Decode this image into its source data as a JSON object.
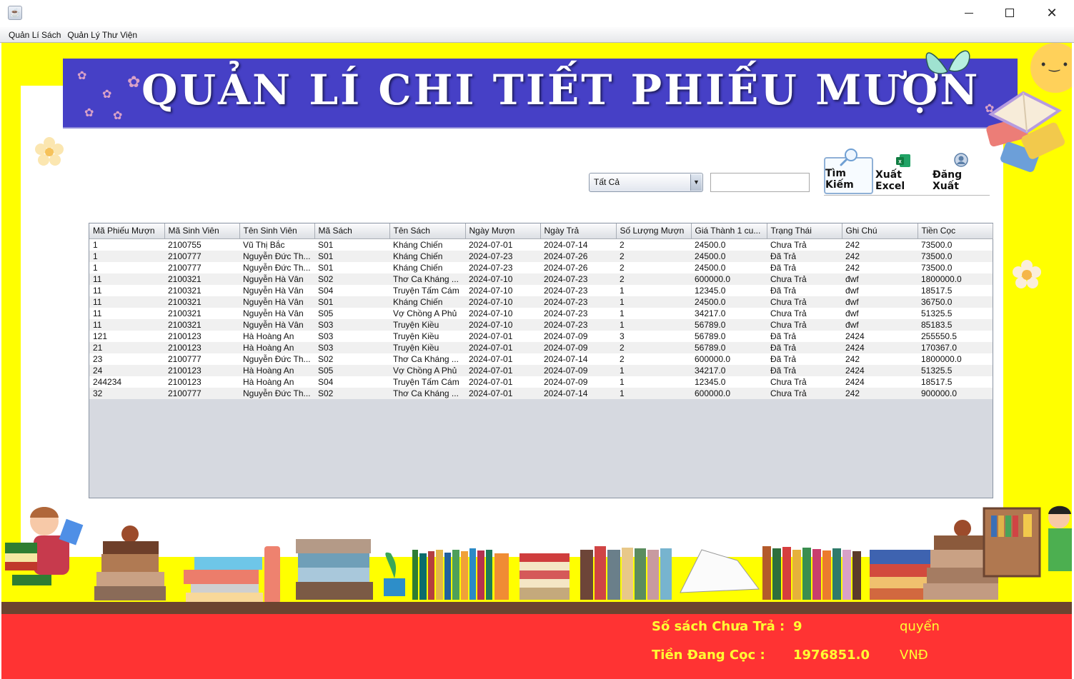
{
  "window": {
    "icon": "java-cup-icon",
    "controls": {
      "minimize": "minimize",
      "maximize": "maximize",
      "close": "close"
    }
  },
  "menu": {
    "items": [
      {
        "label": "Quản Lí Sách"
      },
      {
        "label": "Quản Lý Thư Viện"
      }
    ]
  },
  "banner": {
    "title": "QUẢN LÍ CHI TIẾT PHIẾU MƯỢN"
  },
  "search": {
    "filter_selected": "Tất Cả",
    "query_value": "",
    "search_label": "Tìm Kiếm",
    "excel_label": "Xuất Excel",
    "logout_label": "Đăng Xuất"
  },
  "table": {
    "columns": [
      "Mã Phiếu Mượn",
      "Mã Sinh Viên",
      "Tên Sinh Viên",
      "Mã Sách",
      "Tên Sách",
      "Ngày Mượn",
      "Ngày Trả",
      "Số Lượng Mượn",
      "Giá Thành 1 cu...",
      "Trạng Thái",
      "Ghi Chú",
      "Tiền Cọc"
    ],
    "rows": [
      [
        "1",
        "2100755",
        "Vũ Thị Bắc",
        "S01",
        "Kháng Chiến",
        "2024-07-01",
        "2024-07-14",
        "2",
        "24500.0",
        "Chưa Trả",
        "242",
        "73500.0"
      ],
      [
        "1",
        "2100777",
        "Nguyễn Đức Th...",
        "S01",
        "Kháng Chiến",
        "2024-07-23",
        "2024-07-26",
        "2",
        "24500.0",
        "Đã Trả",
        "242",
        "73500.0"
      ],
      [
        "1",
        "2100777",
        "Nguyễn Đức Th...",
        "S01",
        "Kháng Chiến",
        "2024-07-23",
        "2024-07-26",
        "2",
        "24500.0",
        "Đã Trả",
        "242",
        "73500.0"
      ],
      [
        "11",
        "2100321",
        "Nguyễn Hà Vân",
        "S02",
        "Thơ Ca Kháng ...",
        "2024-07-10",
        "2024-07-23",
        "2",
        "600000.0",
        "Chưa Trả",
        "đwf",
        "1800000.0"
      ],
      [
        "11",
        "2100321",
        "Nguyễn Hà Vân",
        "S04",
        "Truyện Tấm Cám",
        "2024-07-10",
        "2024-07-23",
        "1",
        "12345.0",
        "Đã Trả",
        "đwf",
        "18517.5"
      ],
      [
        "11",
        "2100321",
        "Nguyễn Hà Vân",
        "S01",
        "Kháng Chiến",
        "2024-07-10",
        "2024-07-23",
        "1",
        "24500.0",
        "Chưa Trả",
        "đwf",
        "36750.0"
      ],
      [
        "11",
        "2100321",
        "Nguyễn Hà Vân",
        "S05",
        "Vợ Chồng A Phủ",
        "2024-07-10",
        "2024-07-23",
        "1",
        "34217.0",
        "Chưa Trả",
        "đwf",
        "51325.5"
      ],
      [
        "11",
        "2100321",
        "Nguyễn Hà Vân",
        "S03",
        "Truyện Kiều",
        "2024-07-10",
        "2024-07-23",
        "1",
        "56789.0",
        "Chưa Trả",
        "đwf",
        "85183.5"
      ],
      [
        "121",
        "2100123",
        "Hà Hoàng An",
        "S03",
        "Truyện Kiều",
        "2024-07-01",
        "2024-07-09",
        "3",
        "56789.0",
        "Đã Trả",
        "2424",
        "255550.5"
      ],
      [
        "21",
        "2100123",
        "Hà Hoàng An",
        "S03",
        "Truyện Kiều",
        "2024-07-01",
        "2024-07-09",
        "2",
        "56789.0",
        "Đã Trả",
        "2424",
        "170367.0"
      ],
      [
        "23",
        "2100777",
        "Nguyễn Đức Th...",
        "S02",
        "Thơ Ca Kháng ...",
        "2024-07-01",
        "2024-07-14",
        "2",
        "600000.0",
        "Đã Trả",
        "242",
        "1800000.0"
      ],
      [
        "24",
        "2100123",
        "Hà Hoàng An",
        "S05",
        "Vợ Chồng A Phủ",
        "2024-07-01",
        "2024-07-09",
        "1",
        "34217.0",
        "Đã Trả",
        "2424",
        "51325.5"
      ],
      [
        "244234",
        "2100123",
        "Hà Hoàng An",
        "S04",
        "Truyện Tấm Cám",
        "2024-07-01",
        "2024-07-09",
        "1",
        "12345.0",
        "Chưa Trả",
        "2424",
        "18517.5"
      ],
      [
        "32",
        "2100777",
        "Nguyễn Đức Th...",
        "S02",
        "Thơ Ca Kháng ...",
        "2024-07-01",
        "2024-07-14",
        "1",
        "600000.0",
        "Chưa Trả",
        "242",
        "900000.0"
      ]
    ]
  },
  "footer": {
    "unreturned_label": "Số sách Chưa Trả :",
    "unreturned_value": "9",
    "unreturned_unit": "quyển",
    "deposit_label": "Tiền Đang Cọc :",
    "deposit_value": "1976851.0",
    "deposit_unit": "VNĐ"
  },
  "colors": {
    "background_yellow": "#ffff00",
    "banner_blue": "#4640c6",
    "footer_red": "#ff3333",
    "footer_text": "#ffff33"
  }
}
